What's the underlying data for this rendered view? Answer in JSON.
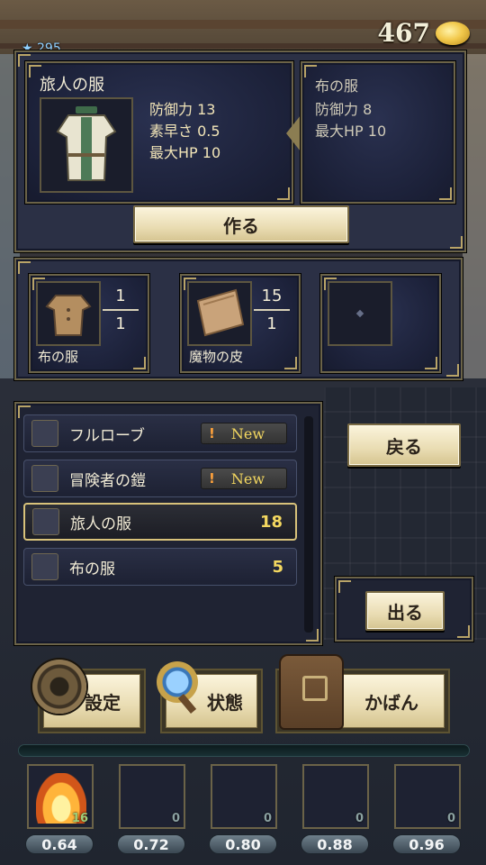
{
  "header": {
    "gold": "467",
    "level": "295"
  },
  "craft": {
    "item_name": "旅人の服",
    "stats": [
      "防御力 13",
      "素早さ 0.5",
      "最大HP 10"
    ],
    "compare_name": "布の服",
    "compare_stats": [
      "防御力 8",
      "最大HP 10"
    ],
    "make_label": "作る"
  },
  "materials": [
    {
      "name": "布の服",
      "have": "1",
      "need": "1"
    },
    {
      "name": "魔物の皮",
      "have": "15",
      "need": "1"
    }
  ],
  "recipes": [
    {
      "name": "フルローブ",
      "new_label": "New",
      "icon": "robe-icon"
    },
    {
      "name": "冒険者の鎧",
      "new_label": "New",
      "icon": "armor-icon"
    },
    {
      "name": "旅人の服",
      "count": "18",
      "icon": "tunic-icon",
      "selected": true
    },
    {
      "name": "布の服",
      "count": "5",
      "icon": "cloth-icon"
    }
  ],
  "new_badge_mark": "!",
  "buttons": {
    "back": "戻る",
    "exit": "出る"
  },
  "menu": {
    "settings": "設定",
    "status": "状態",
    "bag": "かばん"
  },
  "quickslots": [
    {
      "qty": "16",
      "label": "0.64",
      "icon": "fire-icon"
    },
    {
      "qty": "0",
      "label": "0.72"
    },
    {
      "qty": "0",
      "label": "0.80"
    },
    {
      "qty": "0",
      "label": "0.88"
    },
    {
      "qty": "0",
      "label": "0.96"
    }
  ]
}
